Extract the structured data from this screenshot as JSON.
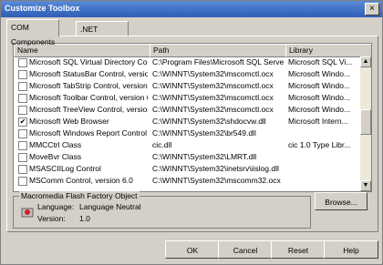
{
  "window": {
    "title": "Customize Toolbox",
    "close_label": "×"
  },
  "tabs": [
    {
      "label": "COM Components",
      "active": true
    },
    {
      "label": ".NET Framework Components",
      "active": false
    }
  ],
  "list": {
    "columns": [
      "Name",
      "Path",
      "Library"
    ],
    "rows": [
      {
        "checked": false,
        "name": "Microsoft SQL Virtual Directory Con...",
        "path": "C:\\Program Files\\Microsoft SQL Serve...",
        "library": "Microsoft SQL Vi..."
      },
      {
        "checked": false,
        "name": "Microsoft StatusBar Control, versio...",
        "path": "C:\\WINNT\\System32\\mscomctl.ocx",
        "library": "Microsoft Windo..."
      },
      {
        "checked": false,
        "name": "Microsoft TabStrip Control, version ...",
        "path": "C:\\WINNT\\System32\\mscomctl.ocx",
        "library": "Microsoft Windo..."
      },
      {
        "checked": false,
        "name": "Microsoft Toolbar Control, version 6.0",
        "path": "C:\\WINNT\\System32\\mscomctl.ocx",
        "library": "Microsoft Windo..."
      },
      {
        "checked": false,
        "name": "Microsoft TreeView Control, version 6.0",
        "path": "C:\\WINNT\\System32\\mscomctl.ocx",
        "library": "Microsoft Windo..."
      },
      {
        "checked": true,
        "name": "Microsoft Web Browser",
        "path": "C:\\WINNT\\System32\\shdocvw.dll",
        "library": "Microsoft Intern..."
      },
      {
        "checked": false,
        "name": "Microsoft Windows Report Control",
        "path": "C:\\WINNT\\System32\\br549.dll",
        "library": ""
      },
      {
        "checked": false,
        "name": "MMCCtrl Class",
        "path": "cic.dll",
        "library": "cic 1.0 Type Libr..."
      },
      {
        "checked": false,
        "name": "MoveBvr Class",
        "path": "C:\\WINNT\\System32\\LMRT.dll",
        "library": ""
      },
      {
        "checked": false,
        "name": "MSASCIILog Control",
        "path": "C:\\WINNT\\System32\\inetsrv\\iislog.dll",
        "library": ""
      },
      {
        "checked": false,
        "name": "MSComm Control, version 6.0",
        "path": "C:\\WINNT\\System32\\mscomm32.ocx",
        "library": ""
      }
    ]
  },
  "details": {
    "name": "Macromedia Flash Factory Object",
    "language_label": "Language:",
    "language_value": "Language Neutral",
    "version_label": "Version:",
    "version_value": "1.0",
    "browse_label": "Browse..."
  },
  "buttons": {
    "ok": "OK",
    "cancel": "Cancel",
    "reset": "Reset",
    "help": "Help"
  }
}
